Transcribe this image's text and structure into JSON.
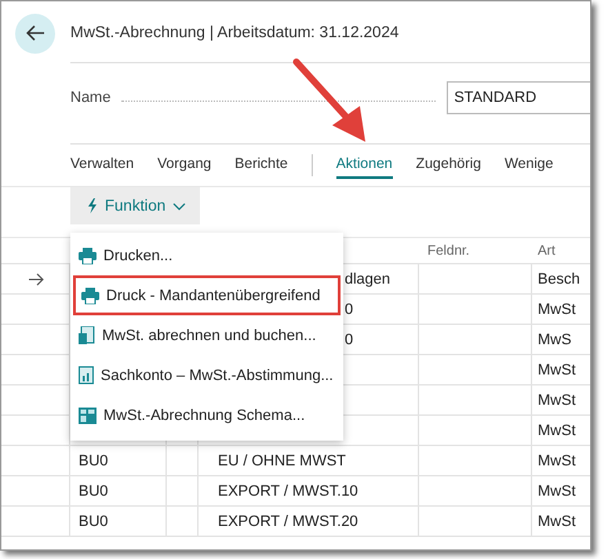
{
  "header": {
    "title": "MwSt.-Abrechnung | Arbeitsdatum: 31.12.2024"
  },
  "name_field": {
    "label": "Name",
    "value": "STANDARD"
  },
  "tabs": [
    {
      "label": "Verwalten",
      "selected": false
    },
    {
      "label": "Vorgang",
      "selected": false
    },
    {
      "label": "Berichte",
      "selected": false
    },
    {
      "label": "Aktionen",
      "selected": true
    },
    {
      "label": "Zugehörig",
      "selected": false
    },
    {
      "label": "Wenige",
      "selected": false
    }
  ],
  "function_button": {
    "label": "Funktion"
  },
  "menu": [
    {
      "label": "Drucken...",
      "kind": "printer",
      "highlighted": false
    },
    {
      "label": "Druck - Mandantenübergreifend",
      "kind": "printer",
      "highlighted": true
    },
    {
      "label": "MwSt. abrechnen und buchen...",
      "kind": "post",
      "highlighted": false
    },
    {
      "label": "Sachkonto – MwSt.-Abstimmung...",
      "kind": "report",
      "highlighted": false
    },
    {
      "label": "MwSt.-Abrechnung Schema...",
      "kind": "schema",
      "highlighted": false
    }
  ],
  "table": {
    "columns": [
      "Feldnr.",
      "Art"
    ],
    "rows": [
      {
        "current": true,
        "description": "dlagen",
        "covered": true,
        "type": "Besch"
      },
      {
        "current": false,
        "description": "0",
        "covered": true,
        "type": "MwSt"
      },
      {
        "current": false,
        "description": "0",
        "covered": true,
        "type": "MwS"
      },
      {
        "current": false,
        "type": "MwSt"
      },
      {
        "current": false,
        "type": "MwSt"
      },
      {
        "current": false,
        "type": "MwSt"
      },
      {
        "current": false,
        "code": "BU0",
        "description": "EU / OHNE MWST",
        "covered": false,
        "type": "MwSt"
      },
      {
        "current": false,
        "code": "BU0",
        "description": "EXPORT / MWST.10",
        "covered": false,
        "type": "MwSt"
      },
      {
        "current": false,
        "code": "BU0",
        "description": "EXPORT / MWST.20",
        "covered": false,
        "type": "MwSt"
      }
    ]
  }
}
